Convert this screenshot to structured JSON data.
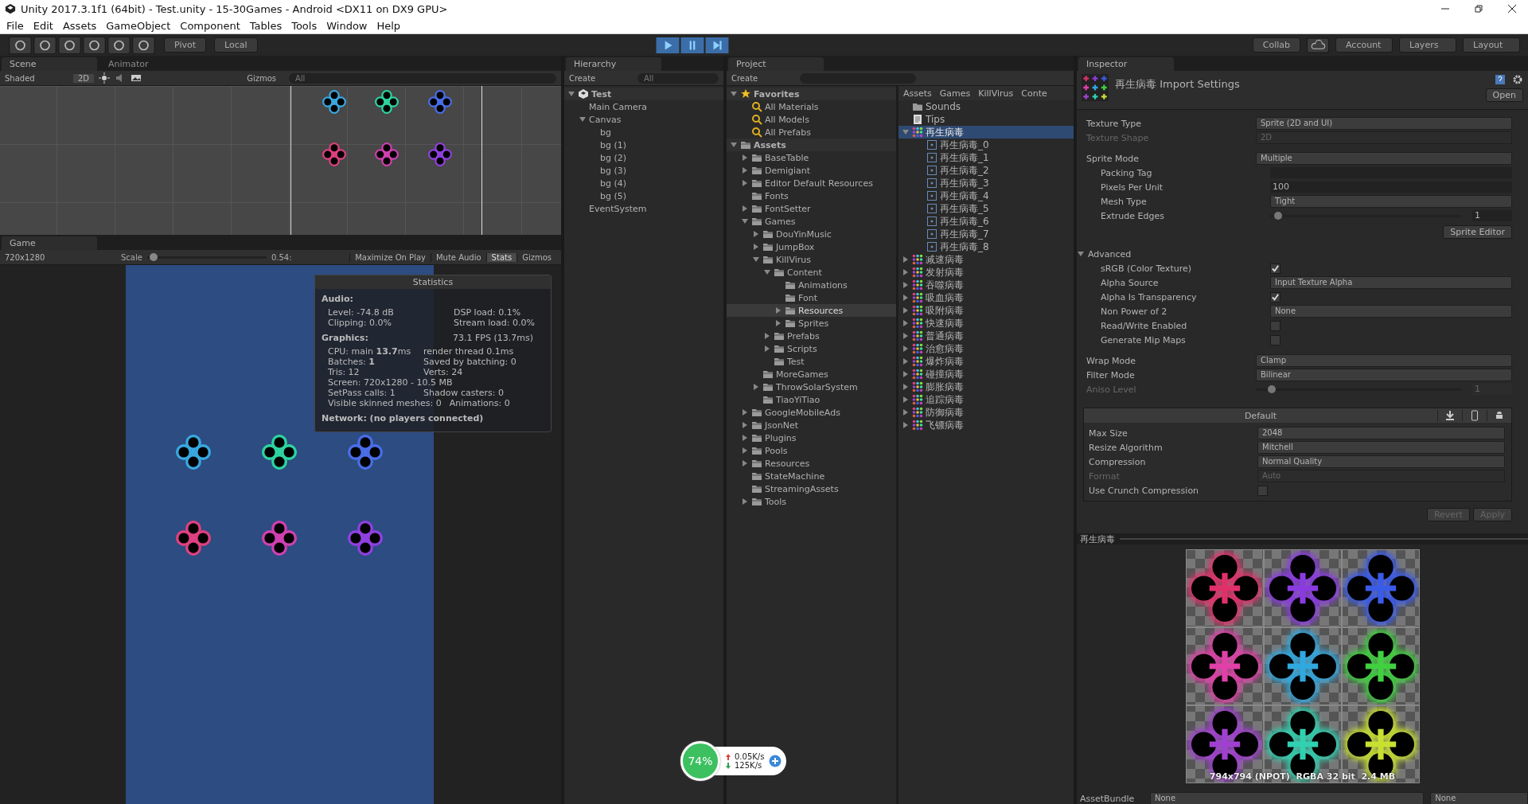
{
  "window": {
    "title": "Unity 2017.3.1f1 (64bit) - Test.unity - 15-30Games - Android <DX11 on DX9 GPU>"
  },
  "menu": [
    "File",
    "Edit",
    "Assets",
    "GameObject",
    "Component",
    "Tables",
    "Tools",
    "Window",
    "Help"
  ],
  "toolbar": {
    "pivot": "Pivot",
    "local": "Local",
    "play_mode": true,
    "collab": "Collab",
    "account": "Account",
    "layers": "Layers",
    "layout": "Layout"
  },
  "scene": {
    "tabs": [
      {
        "label": "Scene",
        "selected": true
      },
      {
        "label": "Animator",
        "selected": false
      }
    ],
    "shading": "Shaded",
    "mode_2d": "2D",
    "gizmos": "Gizmos",
    "search": "All",
    "sprites": [
      {
        "color": "#3aa8e0"
      },
      {
        "color": "#2ed4a0"
      },
      {
        "color": "#4a6ee8"
      },
      {
        "color": "#e04080"
      },
      {
        "color": "#d040b0"
      },
      {
        "color": "#9040e0"
      }
    ]
  },
  "game": {
    "tab": "Game",
    "resolution": "720x1280",
    "scale": {
      "label": "Scale",
      "level": 0.02,
      "reading": "0.54:"
    },
    "toggles": [
      {
        "label": "Maximize On Play",
        "on": false
      },
      {
        "label": "Mute Audio",
        "on": false
      },
      {
        "label": "Stats",
        "on": true
      },
      {
        "label": "Gizmos",
        "on": false
      }
    ],
    "sprites": [
      {
        "color": "#3aa8e0"
      },
      {
        "color": "#2ed4a0"
      },
      {
        "color": "#4a6ee8"
      },
      {
        "color": "#e04080"
      },
      {
        "color": "#d040b0"
      },
      {
        "color": "#9040e0"
      }
    ],
    "stats": {
      "title": "Statistics",
      "audio_heading": "Audio:",
      "audio": [
        [
          "Level: -74.8 dB",
          "DSP load: 0.1%"
        ],
        [
          "Clipping: 0.0%",
          "Stream load: 0.0%"
        ]
      ],
      "graphics_heading": "Graphics:",
      "fps": "73.1 FPS (13.7ms)",
      "graphics": [
        [
          "CPU: main **13.7**ms",
          "render thread 0.1ms"
        ],
        [
          "Batches: **1**",
          "Saved by batching: 0"
        ],
        [
          "Tris: 12",
          "Verts: 24"
        ],
        [
          "Screen: 720x1280 - 10.5 MB"
        ],
        [
          "SetPass calls: 1",
          "Shadow casters: 0"
        ],
        [
          "Visible skinned meshes: 0",
          "Animations: 0"
        ]
      ],
      "network": "Network: (no players connected)"
    }
  },
  "hierarchy": {
    "tab": "Hierarchy",
    "create": "Create",
    "search": "All",
    "items": [
      {
        "label": "Test",
        "kind": "scene",
        "expanded": true,
        "selected": false,
        "children": [
          {
            "label": "Main Camera",
            "selected": false
          },
          {
            "label": "Canvas",
            "expanded": true,
            "selected": false,
            "children": [
              {
                "label": "bg",
                "selected": false
              },
              {
                "label": "bg (1)",
                "selected": false
              },
              {
                "label": "bg (2)",
                "selected": false
              },
              {
                "label": "bg (3)",
                "selected": false
              },
              {
                "label": "bg (4)",
                "selected": false
              },
              {
                "label": "bg (5)",
                "selected": false
              }
            ]
          },
          {
            "label": "EventSystem",
            "selected": false
          }
        ]
      }
    ]
  },
  "project": {
    "tab": "Project",
    "create": "Create",
    "tree": [
      {
        "label": "Favorites",
        "kind": "favorites",
        "expanded": true,
        "selected": false,
        "children": [
          {
            "label": "All Materials",
            "kind": "search",
            "selected": false
          },
          {
            "label": "All Models",
            "kind": "search",
            "selected": false
          },
          {
            "label": "All Prefabs",
            "kind": "search",
            "selected": false
          }
        ]
      },
      {
        "label": "Assets",
        "kind": "folder",
        "expanded": true,
        "selected": false,
        "children": [
          {
            "label": "BaseTable",
            "kind": "folder",
            "expanded": false,
            "selected": false
          },
          {
            "label": "Demigiant",
            "kind": "folder",
            "expanded": false,
            "selected": false
          },
          {
            "label": "Editor Default Resources",
            "kind": "folder",
            "expanded": false,
            "selected": false
          },
          {
            "label": "Fonts",
            "kind": "folder",
            "selected": false
          },
          {
            "label": "FontSetter",
            "kind": "folder",
            "expanded": false,
            "selected": false
          },
          {
            "label": "Games",
            "kind": "folder",
            "expanded": true,
            "selected": false,
            "children": [
              {
                "label": "DouYinMusic",
                "kind": "folder",
                "expanded": false,
                "selected": false
              },
              {
                "label": "JumpBox",
                "kind": "folder",
                "expanded": false,
                "selected": false
              },
              {
                "label": "KillVirus",
                "kind": "folder",
                "expanded": true,
                "selected": false,
                "children": [
                  {
                    "label": "Content",
                    "kind": "folder",
                    "expanded": true,
                    "selected": false,
                    "children": [
                      {
                        "label": "Animations",
                        "kind": "folder",
                        "selected": false
                      },
                      {
                        "label": "Font",
                        "kind": "folder",
                        "selected": false
                      },
                      {
                        "label": "Resources",
                        "kind": "folder",
                        "expanded": false,
                        "selected": true
                      },
                      {
                        "label": "Sprites",
                        "kind": "folder",
                        "expanded": false,
                        "selected": false
                      }
                    ]
                  },
                  {
                    "label": "Prefabs",
                    "kind": "folder",
                    "expanded": false,
                    "selected": false
                  },
                  {
                    "label": "Scripts",
                    "kind": "folder",
                    "expanded": false,
                    "selected": false
                  },
                  {
                    "label": "Test",
                    "kind": "folder",
                    "selected": false
                  }
                ]
              },
              {
                "label": "MoreGames",
                "kind": "folder",
                "selected": false
              },
              {
                "label": "ThrowSolarSystem",
                "kind": "folder",
                "expanded": false,
                "selected": false
              },
              {
                "label": "TiaoYiTiao",
                "kind": "folder",
                "selected": false
              }
            ]
          },
          {
            "label": "GoogleMobileAds",
            "kind": "folder",
            "expanded": false,
            "selected": false
          },
          {
            "label": "JsonNet",
            "kind": "folder",
            "expanded": false,
            "selected": false
          },
          {
            "label": "Plugins",
            "kind": "folder",
            "expanded": false,
            "selected": false
          },
          {
            "label": "Pools",
            "kind": "folder",
            "expanded": false,
            "selected": false
          },
          {
            "label": "Resources",
            "kind": "folder",
            "expanded": false,
            "selected": false
          },
          {
            "label": "StateMachine",
            "kind": "folder",
            "selected": false
          },
          {
            "label": "StreamingAssets",
            "kind": "folder",
            "selected": false
          },
          {
            "label": "Tools",
            "kind": "folder",
            "expanded": false,
            "selected": false
          }
        ]
      }
    ],
    "breadcrumb": [
      "Assets",
      "Games",
      "KillVirus",
      "Conte"
    ],
    "files": [
      {
        "label": "Sounds",
        "kind": "folder",
        "selected": false
      },
      {
        "label": "Tips",
        "kind": "text",
        "selected": false
      },
      {
        "label": "再生病毒",
        "kind": "sheet",
        "expanded": true,
        "selected": true,
        "children": [
          {
            "label": "再生病毒_0",
            "kind": "sprite",
            "selected": false
          },
          {
            "label": "再生病毒_1",
            "kind": "sprite",
            "selected": false
          },
          {
            "label": "再生病毒_2",
            "kind": "sprite",
            "selected": false
          },
          {
            "label": "再生病毒_3",
            "kind": "sprite",
            "selected": false
          },
          {
            "label": "再生病毒_4",
            "kind": "sprite",
            "selected": false
          },
          {
            "label": "再生病毒_5",
            "kind": "sprite",
            "selected": false
          },
          {
            "label": "再生病毒_6",
            "kind": "sprite",
            "selected": false
          },
          {
            "label": "再生病毒_7",
            "kind": "sprite",
            "selected": false
          },
          {
            "label": "再生病毒_8",
            "kind": "sprite",
            "selected": false
          }
        ]
      },
      {
        "label": "减速病毒",
        "kind": "sheet",
        "expanded": false,
        "selected": false
      },
      {
        "label": "发射病毒",
        "kind": "sheet",
        "expanded": false,
        "selected": false
      },
      {
        "label": "吞噬病毒",
        "kind": "sheet",
        "expanded": false,
        "selected": false
      },
      {
        "label": "吸血病毒",
        "kind": "sheet",
        "expanded": false,
        "selected": false
      },
      {
        "label": "吸附病毒",
        "kind": "sheet",
        "expanded": false,
        "selected": false
      },
      {
        "label": "快速病毒",
        "kind": "sheet",
        "expanded": false,
        "selected": false
      },
      {
        "label": "普通病毒",
        "kind": "sheet",
        "expanded": false,
        "selected": false
      },
      {
        "label": "治愈病毒",
        "kind": "sheet",
        "expanded": false,
        "selected": false
      },
      {
        "label": "爆炸病毒",
        "kind": "sheet",
        "expanded": false,
        "selected": false
      },
      {
        "label": "碰撞病毒",
        "kind": "sheet",
        "expanded": false,
        "selected": false
      },
      {
        "label": "膨胀病毒",
        "kind": "sheet",
        "expanded": false,
        "selected": false
      },
      {
        "label": "追踪病毒",
        "kind": "sheet",
        "expanded": false,
        "selected": false
      },
      {
        "label": "防御病毒",
        "kind": "sheet",
        "expanded": false,
        "selected": false
      },
      {
        "label": "飞镖病毒",
        "kind": "sheet",
        "expanded": false,
        "selected": false
      }
    ]
  },
  "inspector": {
    "tab": "Inspector",
    "title": "再生病毒 Import Settings",
    "open": "Open",
    "settings": [
      {
        "label": "Texture Type",
        "kind": "dropdown",
        "value": "Sprite (2D and UI)",
        "disabled": false
      },
      {
        "label": "Texture Shape",
        "kind": "dropdown",
        "value": "2D",
        "disabled": true
      },
      {
        "label": "Sprite Mode",
        "kind": "dropdown",
        "value": "Multiple",
        "disabled": false,
        "children": [
          {
            "label": "Packing Tag",
            "kind": "field",
            "disabled": false
          },
          {
            "label": "Pixels Per Unit",
            "kind": "field",
            "value": "100",
            "disabled": false
          },
          {
            "label": "Mesh Type",
            "kind": "dropdown",
            "value": "Tight",
            "disabled": false
          },
          {
            "label": "Extrude Edges",
            "kind": "slider",
            "level": 0.02,
            "value": "1",
            "disabled": false
          },
          {
            "label": "Sprite Editor",
            "kind": "button",
            "disabled": false
          }
        ]
      },
      {
        "label": "Advanced",
        "kind": "foldout",
        "expanded": true,
        "disabled": false,
        "children": [
          {
            "label": "sRGB (Color Texture)",
            "kind": "checkbox",
            "checked": true,
            "disabled": false
          },
          {
            "label": "Alpha Source",
            "kind": "dropdown",
            "value": "Input Texture Alpha",
            "disabled": false
          },
          {
            "label": "Alpha Is Transparency",
            "kind": "checkbox",
            "checked": true,
            "disabled": false
          },
          {
            "label": "Non Power of 2",
            "kind": "dropdown",
            "value": "None",
            "disabled": false
          },
          {
            "label": "Read/Write Enabled",
            "kind": "checkbox",
            "checked": false,
            "disabled": false
          },
          {
            "label": "Generate Mip Maps",
            "kind": "checkbox",
            "checked": false,
            "disabled": false
          }
        ]
      },
      {
        "label": "Wrap Mode",
        "kind": "dropdown",
        "value": "Clamp",
        "disabled": false
      },
      {
        "label": "Filter Mode",
        "kind": "dropdown",
        "value": "Bilinear",
        "disabled": false
      },
      {
        "label": "Aniso Level",
        "kind": "slider",
        "level": 0.06,
        "value": "1",
        "disabled": true
      }
    ],
    "platform": {
      "header": "Default",
      "rows": [
        {
          "label": "Max Size",
          "kind": "dropdown",
          "value": "2048",
          "disabled": false
        },
        {
          "label": "Resize Algorithm",
          "kind": "dropdown",
          "value": "Mitchell",
          "disabled": false
        },
        {
          "label": "Compression",
          "kind": "dropdown",
          "value": "Normal Quality",
          "disabled": false
        },
        {
          "label": "Format",
          "kind": "dropdown",
          "value": "Auto",
          "disabled": true
        },
        {
          "label": "Use Crunch Compression",
          "kind": "checkbox",
          "checked": false,
          "disabled": false
        }
      ]
    },
    "buttons": [
      {
        "label": "Revert",
        "disabled": true
      },
      {
        "label": "Apply",
        "disabled": true
      }
    ],
    "preview": {
      "title": "再生病毒",
      "info": "794x794 (NPOT)  RGBA 32 bit  2.4 MB",
      "cells": [
        {
          "color": "#e0306a"
        },
        {
          "color": "#8a3ae0"
        },
        {
          "color": "#3a5ae8"
        },
        {
          "color": "#e040a8"
        },
        {
          "color": "#30a8e0"
        },
        {
          "color": "#40d040"
        },
        {
          "color": "#a040d0"
        },
        {
          "color": "#30d0b0"
        },
        {
          "color": "#c8e030"
        }
      ]
    },
    "asset_bundle": {
      "label": "AssetBundle",
      "values": [
        "None",
        "None"
      ]
    }
  },
  "net_widget": {
    "percent": "74%",
    "up": "0.05K/s",
    "down": "125K/s"
  }
}
